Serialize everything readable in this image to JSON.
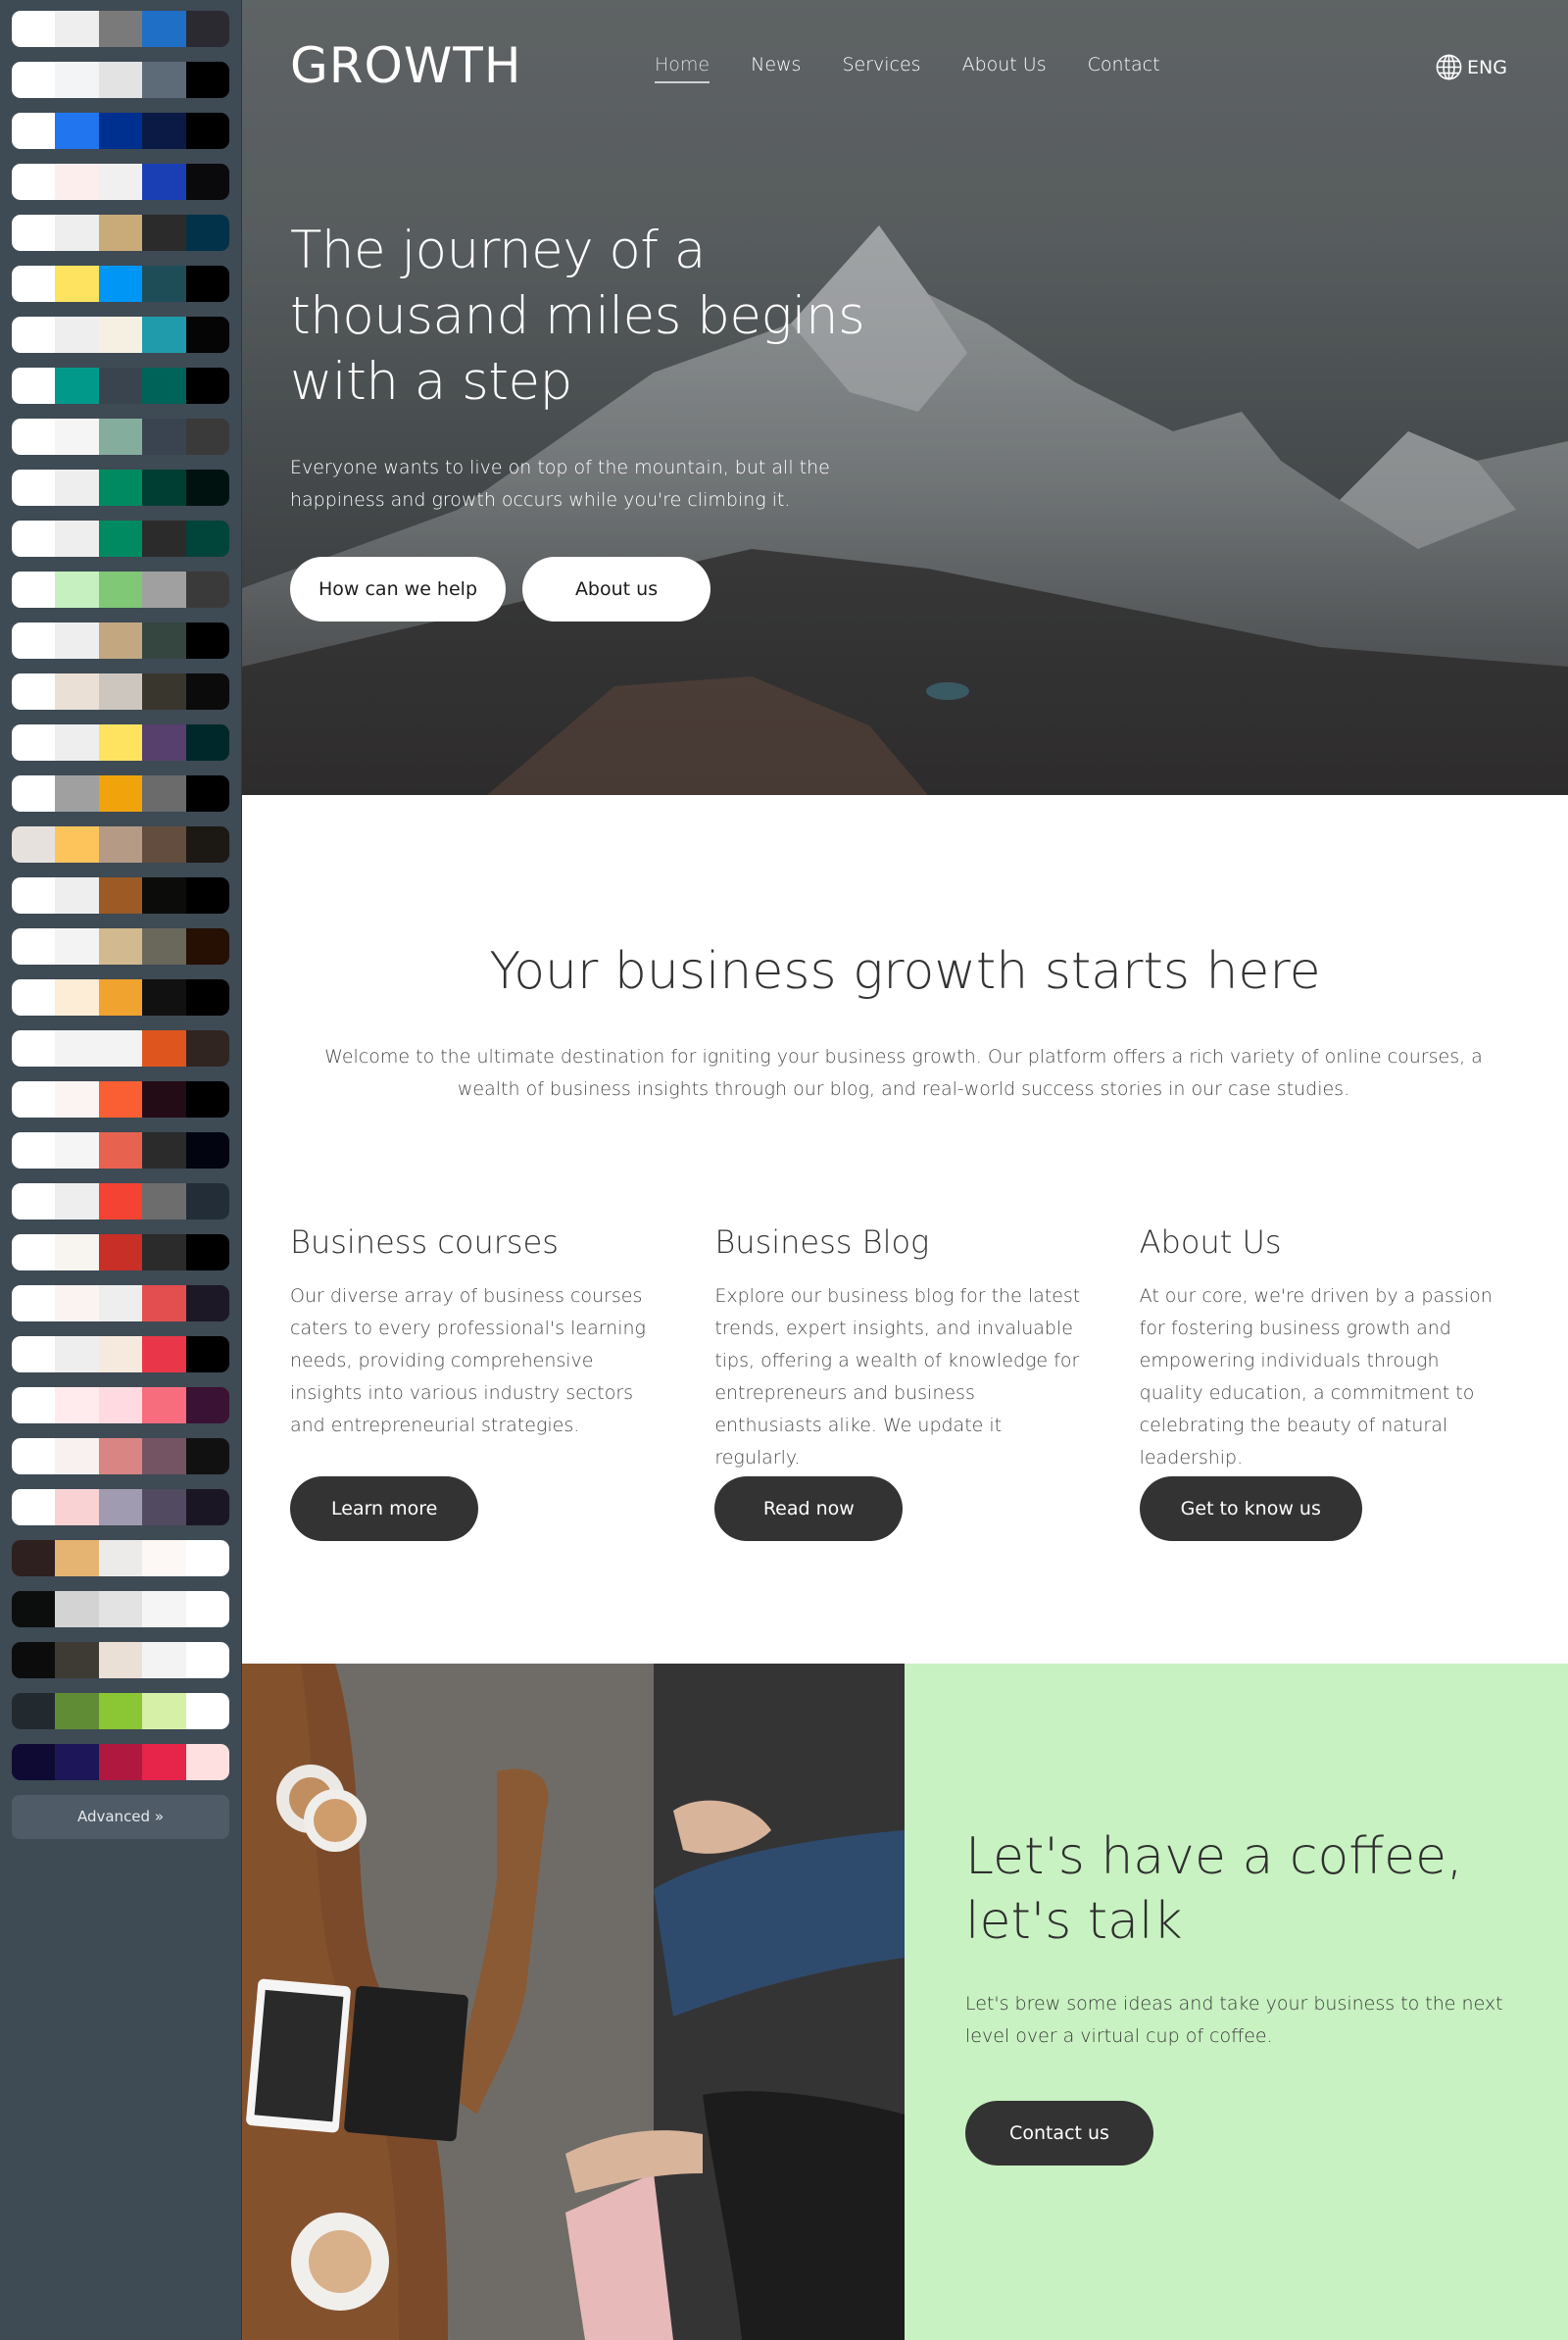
{
  "sidebar": {
    "palettes": [
      [
        "#ffffff",
        "#eeeeee",
        "#7a7a7a",
        "#1f6fc7",
        "#2a2a30"
      ],
      [
        "#ffffff",
        "#f3f4f6",
        "#e3e3e3",
        "#5d6a78",
        "#000000"
      ],
      [
        "#ffffff",
        "#2176f0",
        "#00308f",
        "#0b1a45",
        "#000000"
      ],
      [
        "#ffffff",
        "#fdeeee",
        "#f0f0f0",
        "#1a3fb5",
        "#0a0a0c"
      ],
      [
        "#ffffff",
        "#eeeeee",
        "#c9ab7a",
        "#2b2b2b",
        "#02324a"
      ],
      [
        "#ffffff",
        "#fde35f",
        "#0096f5",
        "#1e4d58",
        "#000000"
      ],
      [
        "#ffffff",
        "#eeeeee",
        "#f6f0e3",
        "#1f9bab",
        "#050505"
      ],
      [
        "#ffffff",
        "#00998a",
        "#39444f",
        "#006359",
        "#000000"
      ],
      [
        "#ffffff",
        "#f5f5f5",
        "#84ad9d",
        "#3a4450",
        "#3a3a3a"
      ],
      [
        "#ffffff",
        "#eeeeee",
        "#008a62",
        "#003d33",
        "#001210"
      ],
      [
        "#ffffff",
        "#eeeeee",
        "#008a62",
        "#2b2b2b",
        "#00443a"
      ],
      [
        "#ffffff",
        "#c7f0c0",
        "#80c776",
        "#a0a0a0",
        "#3a3a3a"
      ],
      [
        "#ffffff",
        "#eeeeee",
        "#c2a781",
        "#34463f",
        "#000000"
      ],
      [
        "#ffffff",
        "#ebe0d6",
        "#ccc6bf",
        "#39362e",
        "#0b0b0b"
      ],
      [
        "#ffffff",
        "#eeeeee",
        "#fde35f",
        "#573f6e",
        "#00282b"
      ],
      [
        "#ffffff",
        "#a0a0a0",
        "#f0a30a",
        "#6b6b6b",
        "#000000"
      ],
      [
        "#e7e1de",
        "#fec45c",
        "#b59a86",
        "#634d3f",
        "#1c1814"
      ],
      [
        "#ffffff",
        "#eeeeee",
        "#9c5a24",
        "#0c0d0a",
        "#000000"
      ],
      [
        "#ffffff",
        "#f3f3f3",
        "#d3b98f",
        "#6a675b",
        "#260f03"
      ],
      [
        "#ffffff",
        "#fdecd6",
        "#f0a32e",
        "#111111",
        "#000000"
      ],
      [
        "#ffffff",
        "#f3f3f3",
        "#f3f3f3",
        "#de561d",
        "#302520"
      ],
      [
        "#ffffff",
        "#fbf4f2",
        "#f95f32",
        "#230c16",
        "#000000"
      ],
      [
        "#ffffff",
        "#f5f5f5",
        "#e76350",
        "#2b2b2b",
        "#020410"
      ],
      [
        "#ffffff",
        "#eeeeee",
        "#f44233",
        "#6d6d6d",
        "#222d38"
      ],
      [
        "#ffffff",
        "#f8f4f0",
        "#c72f27",
        "#2b2b2b",
        "#000000"
      ],
      [
        "#ffffff",
        "#fbf3f2",
        "#eeeeee",
        "#e34e4e",
        "#1d1826"
      ],
      [
        "#ffffff",
        "#eeeeee",
        "#f6e9de",
        "#e93648",
        "#000000"
      ],
      [
        "#ffffff",
        "#ffeaee",
        "#ffdbe1",
        "#f76d7e",
        "#3a1233"
      ],
      [
        "#ffffff",
        "#f8f1ef",
        "#d88584",
        "#745463",
        "#111111"
      ],
      [
        "#ffffff",
        "#f9d2d3",
        "#a19bb1",
        "#514a61",
        "#1b1624"
      ],
      [
        "#2e201e",
        "#e5b472",
        "#edebe9",
        "#fdf8f5",
        "#ffffff"
      ],
      [
        "#0c0e0d",
        "#d3d3d3",
        "#e3e3e3",
        "#f5f5f5",
        "#ffffff"
      ],
      [
        "#0c0c0c",
        "#3d3b33",
        "#ebe0d6",
        "#f3f3f3",
        "#ffffff"
      ],
      [
        "#222a30",
        "#5f8c34",
        "#8bc634",
        "#d6f0a8",
        "#ffffff"
      ],
      [
        "#0f0a33",
        "#1d1658",
        "#b0183f",
        "#e7254b",
        "#ffe0e0"
      ]
    ],
    "advanced_label": "Advanced »"
  },
  "header": {
    "logo": "GROWTH",
    "nav": [
      {
        "label": "Home",
        "active": true
      },
      {
        "label": "News",
        "active": false
      },
      {
        "label": "Services",
        "active": false
      },
      {
        "label": "About Us",
        "active": false
      },
      {
        "label": "Contact",
        "active": false
      }
    ],
    "language": {
      "icon": "globe-icon",
      "label": "ENG"
    }
  },
  "hero": {
    "title": "The journey of a thousand miles begins with a step",
    "subtitle": "Everyone wants to live on top of the mountain, but all the happiness and growth occurs while you're climbing it.",
    "primary_button": "How can we help",
    "secondary_button": "About us"
  },
  "intro": {
    "title": "Your business growth starts here",
    "text": "Welcome to the ultimate destination for igniting your business growth. Our platform offers a rich variety of online courses, a wealth of business insights through our blog, and real-world success stories in our case studies.",
    "features": [
      {
        "title": "Business courses",
        "text": "Our diverse array of business courses caters to every professional's learning needs, providing comprehensive insights into various industry sectors and entrepreneurial strategies.",
        "button": "Learn more"
      },
      {
        "title": "Business Blog",
        "text": "Explore our business blog for the latest trends, expert insights, and invaluable tips, offering a wealth of knowledge for entrepreneurs and business enthusiasts alike. We update it regularly.",
        "button": "Read now"
      },
      {
        "title": "About Us",
        "text": "At our core, we're driven by a passion for fostering business growth and empowering individuals through quality education, a commitment to celebrating the beauty of natural leadership.",
        "button": "Get to know us"
      }
    ]
  },
  "coffee": {
    "title": "Let's have a coffee, let's talk",
    "text": "Let's brew some ideas and take your business to the next level over a virtual cup of coffee.",
    "button": "Contact us"
  },
  "colors": {
    "sidebar_bg": "#3e4a54",
    "button_dark": "#333333",
    "coffee_panel_bg": "#c8f2c1",
    "heading_text": "#333333"
  }
}
